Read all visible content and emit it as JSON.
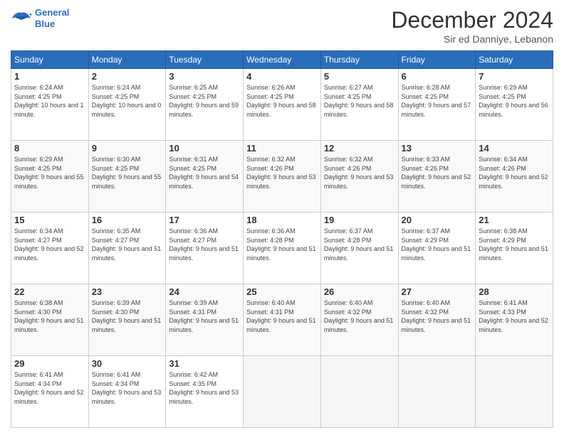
{
  "header": {
    "logo_line1": "General",
    "logo_line2": "Blue",
    "main_title": "December 2024",
    "subtitle": "Sir ed Danniye, Lebanon"
  },
  "calendar": {
    "headers": [
      "Sunday",
      "Monday",
      "Tuesday",
      "Wednesday",
      "Thursday",
      "Friday",
      "Saturday"
    ],
    "weeks": [
      [
        {
          "day": "1",
          "sunrise": "6:24 AM",
          "sunset": "4:25 PM",
          "daylight": "10 hours and 1 minute."
        },
        {
          "day": "2",
          "sunrise": "6:24 AM",
          "sunset": "4:25 PM",
          "daylight": "10 hours and 0 minutes."
        },
        {
          "day": "3",
          "sunrise": "6:25 AM",
          "sunset": "4:25 PM",
          "daylight": "9 hours and 59 minutes."
        },
        {
          "day": "4",
          "sunrise": "6:26 AM",
          "sunset": "4:25 PM",
          "daylight": "9 hours and 58 minutes."
        },
        {
          "day": "5",
          "sunrise": "6:27 AM",
          "sunset": "4:25 PM",
          "daylight": "9 hours and 58 minutes."
        },
        {
          "day": "6",
          "sunrise": "6:28 AM",
          "sunset": "4:25 PM",
          "daylight": "9 hours and 57 minutes."
        },
        {
          "day": "7",
          "sunrise": "6:29 AM",
          "sunset": "4:25 PM",
          "daylight": "9 hours and 56 minutes."
        }
      ],
      [
        {
          "day": "8",
          "sunrise": "6:29 AM",
          "sunset": "4:25 PM",
          "daylight": "9 hours and 55 minutes."
        },
        {
          "day": "9",
          "sunrise": "6:30 AM",
          "sunset": "4:25 PM",
          "daylight": "9 hours and 55 minutes."
        },
        {
          "day": "10",
          "sunrise": "6:31 AM",
          "sunset": "4:25 PM",
          "daylight": "9 hours and 54 minutes."
        },
        {
          "day": "11",
          "sunrise": "6:32 AM",
          "sunset": "4:26 PM",
          "daylight": "9 hours and 53 minutes."
        },
        {
          "day": "12",
          "sunrise": "6:32 AM",
          "sunset": "4:26 PM",
          "daylight": "9 hours and 53 minutes."
        },
        {
          "day": "13",
          "sunrise": "6:33 AM",
          "sunset": "4:26 PM",
          "daylight": "9 hours and 52 minutes."
        },
        {
          "day": "14",
          "sunrise": "6:34 AM",
          "sunset": "4:26 PM",
          "daylight": "9 hours and 52 minutes."
        }
      ],
      [
        {
          "day": "15",
          "sunrise": "6:34 AM",
          "sunset": "4:27 PM",
          "daylight": "9 hours and 52 minutes."
        },
        {
          "day": "16",
          "sunrise": "6:35 AM",
          "sunset": "4:27 PM",
          "daylight": "9 hours and 51 minutes."
        },
        {
          "day": "17",
          "sunrise": "6:36 AM",
          "sunset": "4:27 PM",
          "daylight": "9 hours and 51 minutes."
        },
        {
          "day": "18",
          "sunrise": "6:36 AM",
          "sunset": "4:28 PM",
          "daylight": "9 hours and 51 minutes."
        },
        {
          "day": "19",
          "sunrise": "6:37 AM",
          "sunset": "4:28 PM",
          "daylight": "9 hours and 51 minutes."
        },
        {
          "day": "20",
          "sunrise": "6:37 AM",
          "sunset": "4:29 PM",
          "daylight": "9 hours and 51 minutes."
        },
        {
          "day": "21",
          "sunrise": "6:38 AM",
          "sunset": "4:29 PM",
          "daylight": "9 hours and 51 minutes."
        }
      ],
      [
        {
          "day": "22",
          "sunrise": "6:38 AM",
          "sunset": "4:30 PM",
          "daylight": "9 hours and 51 minutes."
        },
        {
          "day": "23",
          "sunrise": "6:39 AM",
          "sunset": "4:30 PM",
          "daylight": "9 hours and 51 minutes."
        },
        {
          "day": "24",
          "sunrise": "6:39 AM",
          "sunset": "4:31 PM",
          "daylight": "9 hours and 51 minutes."
        },
        {
          "day": "25",
          "sunrise": "6:40 AM",
          "sunset": "4:31 PM",
          "daylight": "9 hours and 51 minutes."
        },
        {
          "day": "26",
          "sunrise": "6:40 AM",
          "sunset": "4:32 PM",
          "daylight": "9 hours and 51 minutes."
        },
        {
          "day": "27",
          "sunrise": "6:40 AM",
          "sunset": "4:32 PM",
          "daylight": "9 hours and 51 minutes."
        },
        {
          "day": "28",
          "sunrise": "6:41 AM",
          "sunset": "4:33 PM",
          "daylight": "9 hours and 52 minutes."
        }
      ],
      [
        {
          "day": "29",
          "sunrise": "6:41 AM",
          "sunset": "4:34 PM",
          "daylight": "9 hours and 52 minutes."
        },
        {
          "day": "30",
          "sunrise": "6:41 AM",
          "sunset": "4:34 PM",
          "daylight": "9 hours and 53 minutes."
        },
        {
          "day": "31",
          "sunrise": "6:42 AM",
          "sunset": "4:35 PM",
          "daylight": "9 hours and 53 minutes."
        },
        null,
        null,
        null,
        null
      ]
    ]
  },
  "labels": {
    "sunrise": "Sunrise:",
    "sunset": "Sunset:",
    "daylight": "Daylight:"
  }
}
